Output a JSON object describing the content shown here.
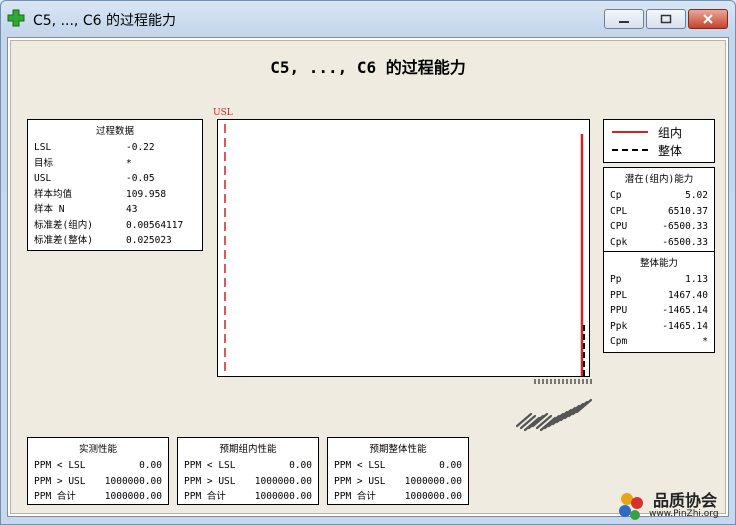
{
  "window": {
    "title": "C5, ..., C6 的过程能力"
  },
  "graph_title": "C5, ..., C6 的过程能力",
  "process_data": {
    "header": "过程数据",
    "rows": [
      {
        "label": "LSL",
        "value": "-0.22"
      },
      {
        "label": "目标",
        "value": "*"
      },
      {
        "label": "USL",
        "value": "-0.05"
      },
      {
        "label": "样本均值",
        "value": "109.958"
      },
      {
        "label": "样本 N",
        "value": "43"
      },
      {
        "label": "标准差(组内)",
        "value": "0.00564117"
      },
      {
        "label": "标准差(整体)",
        "value": "0.025023"
      }
    ]
  },
  "legend": {
    "items": [
      {
        "label": "组内",
        "style": "solid",
        "color": "#d22222"
      },
      {
        "label": "整体",
        "style": "dashed",
        "color": "#000000"
      }
    ]
  },
  "within": {
    "header": "潜在(组内)能力",
    "rows": [
      {
        "label": "Cp",
        "value": "5.02"
      },
      {
        "label": "CPL",
        "value": "6510.37"
      },
      {
        "label": "CPU",
        "value": "-6500.33"
      },
      {
        "label": "Cpk",
        "value": "-6500.33"
      }
    ]
  },
  "overall": {
    "header": "整体能力",
    "rows": [
      {
        "label": "Pp",
        "value": "1.13"
      },
      {
        "label": "PPL",
        "value": "1467.40"
      },
      {
        "label": "PPU",
        "value": "-1465.14"
      },
      {
        "label": "Ppk",
        "value": "-1465.14"
      },
      {
        "label": "Cpm",
        "value": "*"
      }
    ]
  },
  "plot": {
    "usl_tag": "USL"
  },
  "perf_boxes": [
    {
      "header": "实测性能",
      "rows": [
        {
          "label": "PPM < LSL",
          "value": "0.00"
        },
        {
          "label": "PPM > USL",
          "value": "1000000.00"
        },
        {
          "label": "PPM 合计",
          "value": "1000000.00"
        }
      ]
    },
    {
      "header": "预期组内性能",
      "rows": [
        {
          "label": "PPM < LSL",
          "value": "0.00"
        },
        {
          "label": "PPM > USL",
          "value": "1000000.00"
        },
        {
          "label": "PPM 合计",
          "value": "1000000.00"
        }
      ]
    },
    {
      "header": "预期整体性能",
      "rows": [
        {
          "label": "PPM < LSL",
          "value": "0.00"
        },
        {
          "label": "PPM > USL",
          "value": "1000000.00"
        },
        {
          "label": "PPM 合计",
          "value": "1000000.00"
        }
      ]
    }
  ],
  "watermark": {
    "name": "品质协会",
    "url": "www.PinZhi.org"
  },
  "colors": {
    "usl": "#d22222",
    "within_curve": "#d22222",
    "overall_curve": "#000000",
    "title_icon": "#2fa836"
  }
}
